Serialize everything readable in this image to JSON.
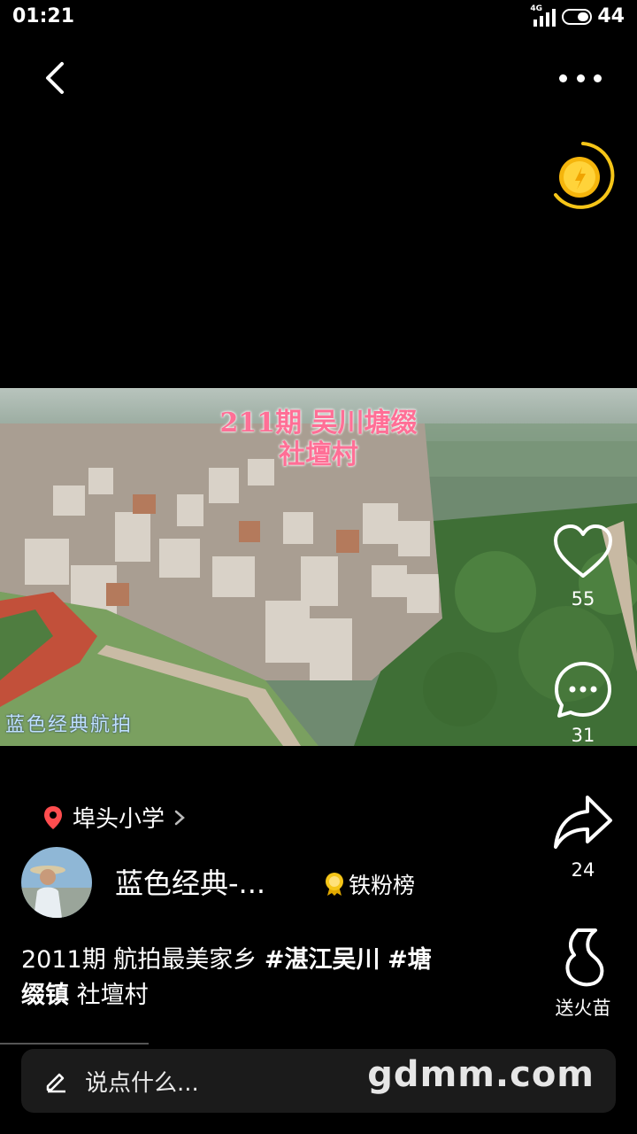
{
  "status": {
    "time": "01:21",
    "network": "4G",
    "battery": "44"
  },
  "video": {
    "overlay_title_line1": "211期 吴川塘缀",
    "overlay_title_line2": "社壇村",
    "watermark": "蓝色经典航拍"
  },
  "actions": {
    "like_count": "55",
    "comment_count": "31",
    "share_count": "24",
    "gift_label": "送火苗"
  },
  "location": {
    "label": "埠头小学"
  },
  "author": {
    "name": "蓝色经典-...",
    "fans_badge": "铁粉榜"
  },
  "caption": {
    "prefix": "2011期 航拍最美家乡 ",
    "tag1": "#湛江吴川",
    "space": " ",
    "tag2a": "#塘",
    "tag2b": "缀镇",
    "suffix": " 社壇村"
  },
  "comment": {
    "placeholder": "说点什么...",
    "watermark": "gdmm.com"
  },
  "colors": {
    "background": "#000000",
    "accent_gold": "#f5c518",
    "pin_red": "#ff4d4f",
    "overlay_pink": "#ff6f96"
  }
}
